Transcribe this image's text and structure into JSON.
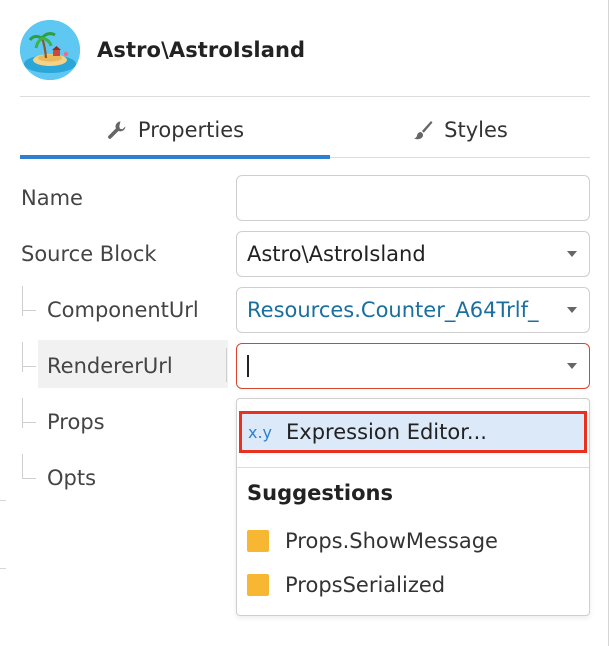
{
  "header": {
    "title": "Astro\\AstroIsland",
    "avatar_icon": "island-icon"
  },
  "tabs": [
    {
      "label": "Properties",
      "icon": "wrench-icon",
      "active": true
    },
    {
      "label": "Styles",
      "icon": "brush-icon",
      "active": false
    }
  ],
  "form": {
    "name": {
      "label": "Name",
      "value": ""
    },
    "source_block": {
      "label": "Source Block",
      "value": "Astro\\AstroIsland"
    },
    "component_url": {
      "label": "ComponentUrl",
      "value": "Resources.Counter_A64Trlf_"
    },
    "renderer_url": {
      "label": "RendererUrl",
      "value": ""
    },
    "props": {
      "label": "Props"
    },
    "opts": {
      "label": "Opts"
    }
  },
  "dropdown": {
    "expression_badge": "x.y",
    "expression_label": "Expression Editor...",
    "suggestions_heading": "Suggestions",
    "suggestions": [
      {
        "label": "Props.ShowMessage",
        "color": "#f7b733"
      },
      {
        "label": "PropsSerialized",
        "color": "#f7b733"
      }
    ]
  },
  "colors": {
    "accent": "#2f7fd1",
    "link": "#1a6f9e",
    "active_border": "#d9452b",
    "highlight_border": "#e8321f"
  }
}
